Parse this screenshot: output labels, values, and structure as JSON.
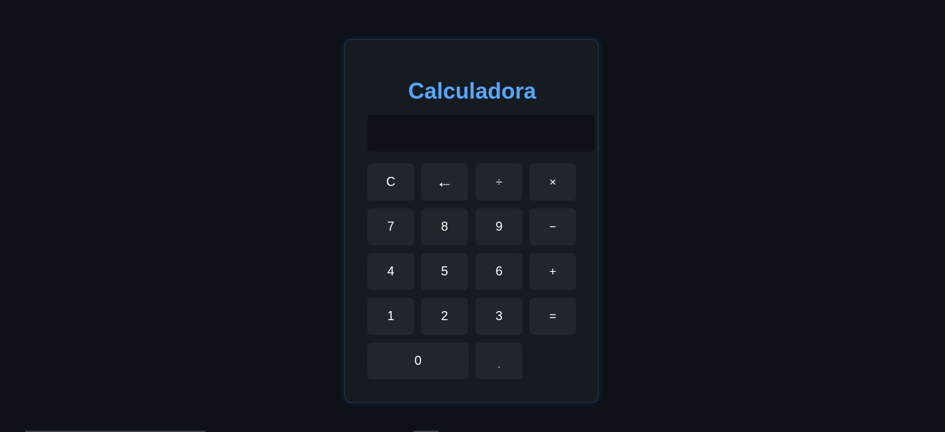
{
  "calculator": {
    "title": "Calculadora",
    "display_value": "",
    "keys": {
      "clear": "C",
      "backspace": "←",
      "divide": "÷",
      "multiply": "×",
      "seven": "7",
      "eight": "8",
      "nine": "9",
      "subtract": "−",
      "four": "4",
      "five": "5",
      "six": "6",
      "add": "+",
      "one": "1",
      "two": "2",
      "three": "3",
      "equals": "=",
      "zero": "0",
      "decimal": "."
    }
  },
  "colors": {
    "page_background": "#0d1117",
    "panel_background": "#161b22",
    "key_background": "#21262d",
    "title_accent": "#58a6ff"
  }
}
